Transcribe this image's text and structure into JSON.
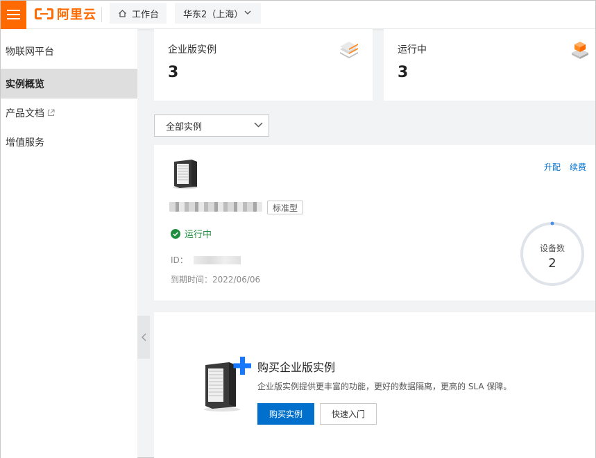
{
  "header": {
    "brand": "阿里云",
    "workbench_label": "工作台",
    "region_label": "华东2（上海）"
  },
  "sidebar": {
    "title": "物联网平台",
    "items": [
      {
        "label": "实例概览",
        "active": true
      },
      {
        "label": "产品文档",
        "external": true
      },
      {
        "label": "增值服务"
      }
    ]
  },
  "stats": [
    {
      "label": "企业版实例",
      "value": "3",
      "icon": "layers-icon"
    },
    {
      "label": "运行中",
      "value": "3",
      "icon": "box-stack-icon"
    }
  ],
  "filter": {
    "selected": "全部实例"
  },
  "instance": {
    "edition_tag": "标准型",
    "status": "运行中",
    "id_label": "ID：",
    "expire_label": "到期时间：2022/06/06",
    "actions": [
      "升配",
      "续费"
    ],
    "device_label": "设备数",
    "device_count": "2",
    "status_color": "#1e8e3e"
  },
  "promo": {
    "title": "购买企业版实例",
    "description": "企业版实例提供更丰富的功能，更好的数据隔离，更高的 SLA 保障。",
    "buy_button": "购买实例",
    "quickstart_button": "快速入门"
  },
  "colors": {
    "brand": "#ff6a00",
    "primary": "#0070cc"
  }
}
